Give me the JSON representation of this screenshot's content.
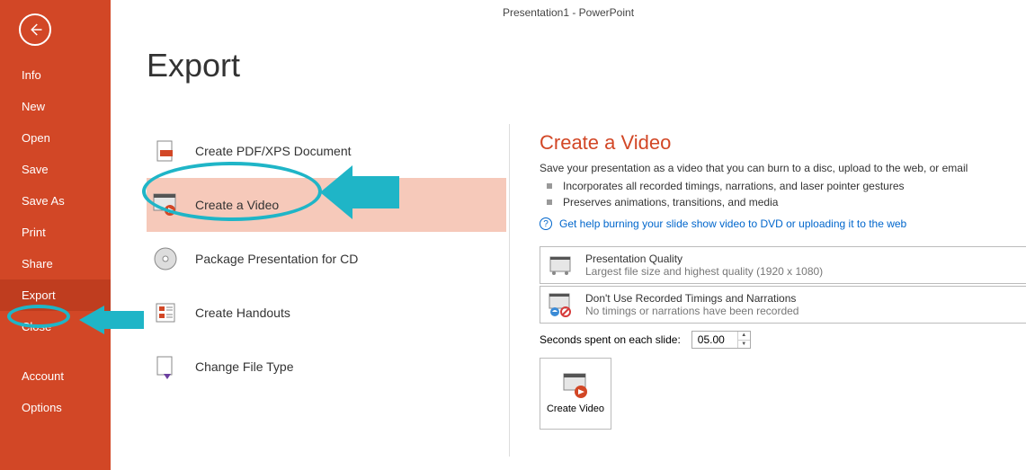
{
  "titlebar": "Presentation1 - PowerPoint",
  "page_title": "Export",
  "sidebar": {
    "items": [
      "Info",
      "New",
      "Open",
      "Save",
      "Save As",
      "Print",
      "Share",
      "Export",
      "Close"
    ],
    "bottom_items": [
      "Account",
      "Options"
    ]
  },
  "export": {
    "options": [
      {
        "label": "Create PDF/XPS Document",
        "icon": "pdf"
      },
      {
        "label": "Create a Video",
        "icon": "video"
      },
      {
        "label": "Package Presentation for CD",
        "icon": "cd"
      },
      {
        "label": "Create Handouts",
        "icon": "handout"
      },
      {
        "label": "Change File Type",
        "icon": "filetype"
      }
    ],
    "selected_index": 1
  },
  "details": {
    "title": "Create a Video",
    "desc": "Save your presentation as a video that you can burn to a disc, upload to the web, or email",
    "bullets": [
      "Incorporates all recorded timings, narrations, and laser pointer gestures",
      "Preserves animations, transitions, and media"
    ],
    "help_link": "Get help burning your slide show video to DVD or uploading it to the web",
    "quality": {
      "title": "Presentation Quality",
      "sub": "Largest file size and highest quality (1920 x 1080)"
    },
    "timings": {
      "title": "Don't Use Recorded Timings and Narrations",
      "sub": "No timings or narrations have been recorded"
    },
    "seconds_label": "Seconds spent on each slide:",
    "seconds_value": "05.00",
    "create_label": "Create Video"
  }
}
